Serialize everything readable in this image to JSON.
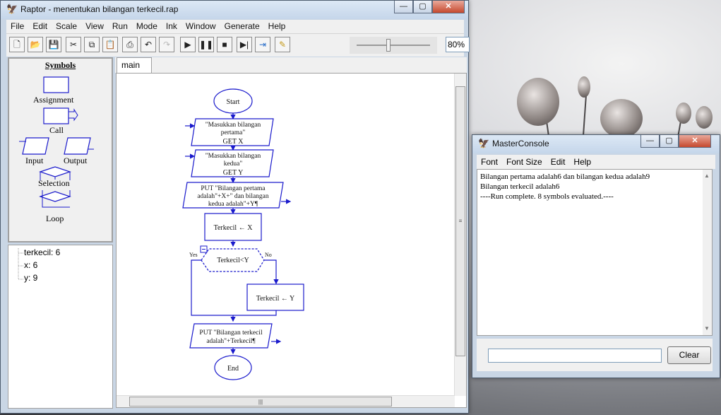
{
  "raptor": {
    "title": "Raptor - menentukan bilangan terkecil.rap",
    "menu": [
      "File",
      "Edit",
      "Scale",
      "View",
      "Run",
      "Mode",
      "Ink",
      "Window",
      "Generate",
      "Help"
    ],
    "zoom": "80%",
    "symbols": {
      "title": "Symbols",
      "assignment": "Assignment",
      "call": "Call",
      "input": "Input",
      "output": "Output",
      "selection": "Selection",
      "loop": "Loop"
    },
    "variables": [
      "terkecil: 6",
      "x: 6",
      "y: 9"
    ],
    "tab": "main",
    "flowchart": {
      "start": "Start",
      "input1_prompt": "\"Masukkan bilangan pertama\"",
      "input1_get": "GET X",
      "input2_prompt": "\"Masukkan bilangan kedua\"",
      "input2_get": "GET Y",
      "output1": "PUT \"Bilangan pertama adalah\"+X+\" dan bilangan kedua adalah\"+Y¶",
      "assign1": "Terkecil ← X",
      "condition": "Terkecil<Y",
      "yes": "Yes",
      "no": "No",
      "assign2": "Terkecil ← Y",
      "output2": "PUT \"Bilangan terkecil adalah\"+Terkecil¶",
      "end": "End"
    }
  },
  "console": {
    "title": "MasterConsole",
    "menu": [
      "Font",
      "Font Size",
      "Edit",
      "Help"
    ],
    "lines": [
      "Bilangan pertama adalah6 dan bilangan kedua adalah9",
      "Bilangan terkecil adalah6",
      "----Run complete.  8 symbols evaluated.----"
    ],
    "clear_label": "Clear"
  }
}
